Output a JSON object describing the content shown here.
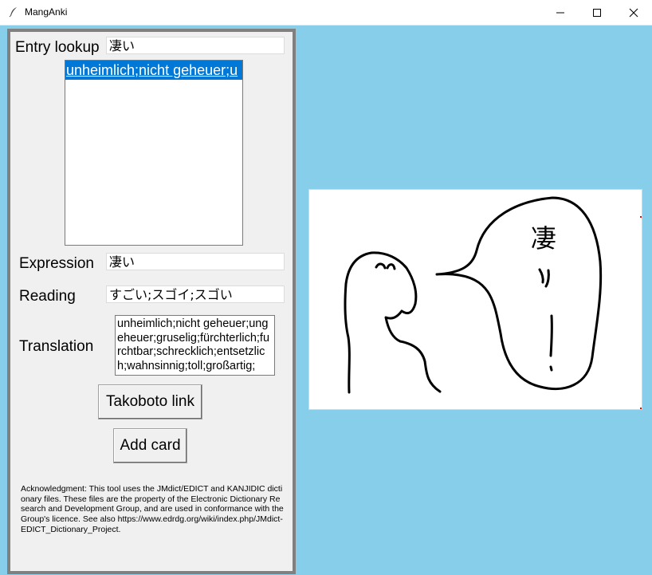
{
  "window": {
    "title": "MangAnki",
    "icon": "feather-icon"
  },
  "lookup": {
    "label": "Entry lookup",
    "value": "凄い",
    "results": [
      "unheimlich;nicht geheuer;u"
    ]
  },
  "fields": {
    "expression_label": "Expression",
    "expression_value": "凄い",
    "reading_label": "Reading",
    "reading_value": "すごい;スゴイ;スゴい",
    "translation_label": "Translation",
    "translation_value": "unheimlich;nicht geheuer;ungeheuer;gruselig;fürchterlich;furchtbar;schrecklich;entsetzlich;wahnsinnig;toll;großartig;"
  },
  "buttons": {
    "takoboto": "Takoboto link",
    "add_card": "Add card"
  },
  "acknowledgment": "Acknowledgment: This tool uses the JMdict/EDICT and KANJIDIC dictionary files. These files are the property of the Electronic Dictionary Research and Development Group, and are used in conformance with the Group's licence. See also https://www.edrdg.org/wiki/index.php/JMdict-EDICT_Dictionary_Project.",
  "image": {
    "speech_text_1": "凄",
    "speech_text_2": "い",
    "speech_text_3": "!"
  },
  "colors": {
    "background": "#87CEEB",
    "selection": "#0078d7",
    "panel_border": "#808080"
  }
}
